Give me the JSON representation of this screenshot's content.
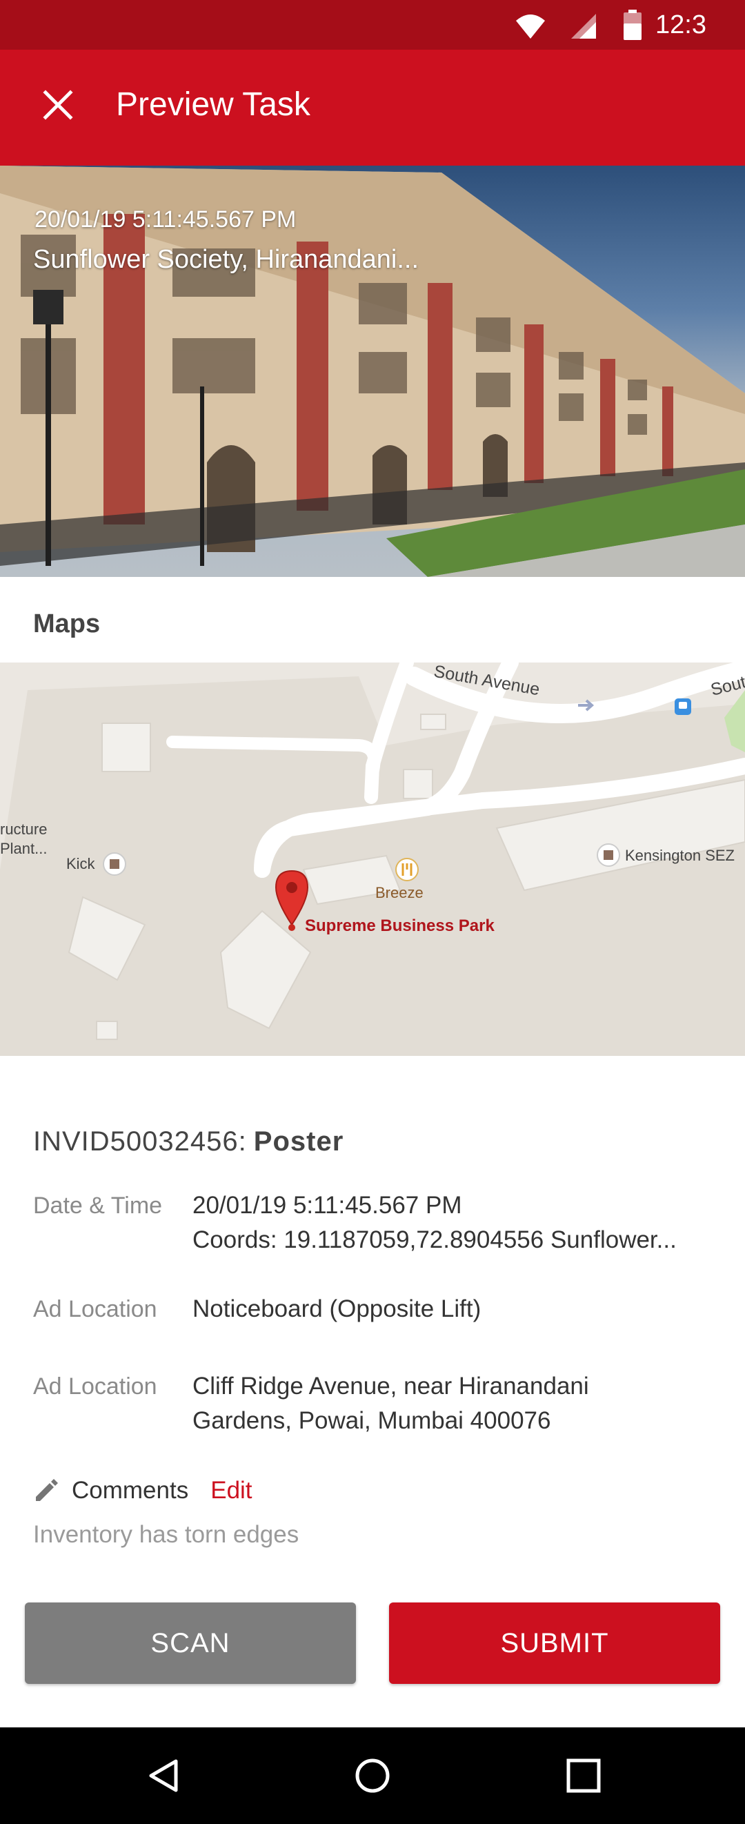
{
  "status_bar": {
    "time": "12:3",
    "icons": [
      "wifi-icon",
      "cell-signal-icon",
      "battery-icon"
    ]
  },
  "app_bar": {
    "title": "Preview Task",
    "close_icon": "close-icon"
  },
  "hero": {
    "datetime": "20/01/19  5:11:45.567 PM",
    "location": "Sunflower Society, Hiranandani..."
  },
  "maps": {
    "heading": "Maps",
    "labels": {
      "south_avenue": "South Avenue",
      "south_cut": "Sout",
      "structure_plant_1": "ructure",
      "structure_plant_2": "Plant...",
      "kick": "Kick",
      "breeze": "Breeze",
      "kensington": "Kensington SEZ",
      "supreme": "Supreme Business Park"
    }
  },
  "task": {
    "id": "INVID50032456:",
    "kind": "Poster",
    "datetime_label": "Date & Time",
    "datetime_line1": "20/01/19  5:11:45.567 PM",
    "datetime_line2": "Coords: 19.1187059,72.8904556 Sunflower...",
    "ad_location_label": "Ad Location",
    "ad_location_value": "Noticeboard (Opposite Lift)",
    "ad_location2_label": "Ad Location",
    "ad_location2_line1": "Cliff Ridge Avenue, near Hiranandani",
    "ad_location2_line2": "Gardens, Powai, Mumbai 400076"
  },
  "comments": {
    "label": "Comments",
    "edit": "Edit",
    "text": "Inventory has torn edges"
  },
  "actions": {
    "scan": "SCAN",
    "submit": "SUBMIT"
  },
  "colors": {
    "primary": "#cc101f",
    "status_bar": "#a50d18",
    "scan_button": "#7d7d7d"
  }
}
